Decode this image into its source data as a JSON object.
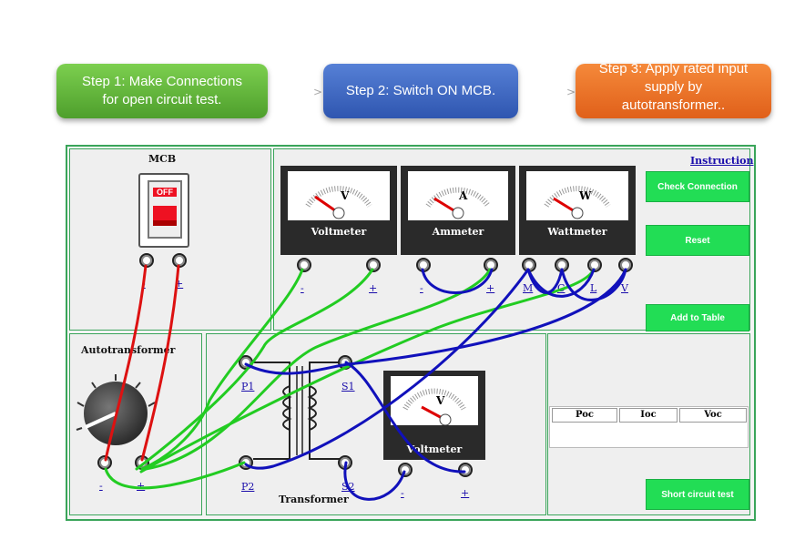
{
  "steps": [
    {
      "label": "Step 1: Make Connections for open circuit test."
    },
    {
      "label": "Step 2: Switch ON MCB."
    },
    {
      "label": "Step 3: Apply rated input supply by autotransformer.."
    }
  ],
  "mcb": {
    "title": "MCB",
    "state": "OFF",
    "term_minus": "-",
    "term_plus": "+"
  },
  "instruction_link": "Instruction",
  "meters": [
    {
      "name": "Voltmeter",
      "unit": "V"
    },
    {
      "name": "Ammeter",
      "unit": "A"
    },
    {
      "name": "Wattmeter",
      "unit": "W"
    }
  ],
  "meter_terminals": {
    "v_minus": "-",
    "v_plus": "+",
    "a_minus": "-",
    "a_plus": "+",
    "w_m": "M",
    "w_c": "C",
    "w_l": "L",
    "w_v": "V"
  },
  "buttons": {
    "check": "Check Connection",
    "reset": "Reset",
    "add": "Add to Table",
    "short": "Short circuit test"
  },
  "autotransformer": {
    "title": "Autotransformer",
    "term_minus": "-",
    "term_plus": "+"
  },
  "transformer": {
    "title": "Transformer",
    "p1": "P1",
    "p2": "P2",
    "s1": "S1",
    "s2": "S2"
  },
  "sec_voltmeter": {
    "name": "Voltmeter",
    "unit": "V",
    "term_minus": "-",
    "term_plus": "+"
  },
  "table": {
    "headers": [
      "Poc",
      "Ioc",
      "Voc"
    ]
  },
  "colors": {
    "red_wire": "#dd1111",
    "green_wire": "#22cc22",
    "blue_wire": "#1111bb",
    "button": "#22dd55"
  }
}
